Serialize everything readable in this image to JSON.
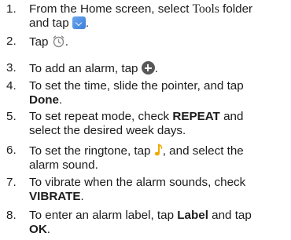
{
  "steps": [
    {
      "num": "1.",
      "pre": "From the Home screen, select ",
      "folder": "Tools",
      "mid": " folder and tap ",
      "post": ".",
      "icon": "tools-folder-icon"
    },
    {
      "num": "2.",
      "pre": "Tap ",
      "post": ".",
      "icon": "clock-app-icon"
    },
    {
      "num": "3.",
      "pre": "To add an alarm, tap ",
      "post": ".",
      "icon": "add-circle-icon"
    },
    {
      "num": "4.",
      "pre": "To set the time, slide the pointer, and tap ",
      "bold": "Done",
      "post": "."
    },
    {
      "num": "5.",
      "pre": "To set repeat mode, check ",
      "bold": "REPEAT",
      "post": " and select the desired week days."
    },
    {
      "num": "6.",
      "pre": "To set the ringtone, tap ",
      "post": ", and select the alarm sound.",
      "icon": "music-note-icon"
    },
    {
      "num": "7.",
      "pre": "To vibrate when the alarm sounds, check ",
      "bold": "VIBRATE",
      "post": "."
    },
    {
      "num": "8.",
      "pre": "To enter an alarm label, tap ",
      "bold": "Label",
      "mid": " and tap ",
      "bold2": "OK",
      "post": "."
    }
  ],
  "colors": {
    "text": "#1c1c1c",
    "tools_icon": "#4a8ce0",
    "add_icon": "#585858",
    "clock_icon": "#8a8a8a",
    "note_icon": "#f2a800"
  }
}
